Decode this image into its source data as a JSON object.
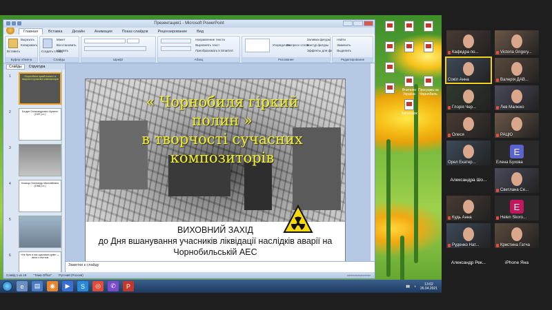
{
  "ppt": {
    "window_title": "Презентация1 - Microsoft PowerPoint",
    "tabs": [
      "Главная",
      "Вставка",
      "Дизайн",
      "Анимация",
      "Показ слайдов",
      "Рецензирование",
      "Вид"
    ],
    "ribbon_groups": [
      "Буфер обмена",
      "Слайды",
      "Шрифт",
      "Абзац",
      "Рисование",
      "Редактирование"
    ],
    "ribbon_buttons": {
      "paste": "Вставить",
      "new_slide": "Создать слайд",
      "cut": "Вырезать",
      "copy": "Копировать",
      "format": "Формат по образцу",
      "layout": "Макет",
      "reset": "Восстановить",
      "delete": "Удалить",
      "text_direction": "Направление текста",
      "align_text": "Выровнять текст",
      "smartart": "Преобразовать в SmartArt",
      "arrange": "Упорядочить",
      "quick_styles": "Экспресс-стили",
      "fill": "Заливка фигуры",
      "outline": "Контур фигуры",
      "effects": "Эффекты для фигур",
      "find": "Найти",
      "replace": "Заменить",
      "select": "Выделить"
    },
    "pane_tabs": [
      "Слайды",
      "Структура"
    ],
    "thumbnails": [
      {
        "num": "1",
        "text": "«Чорнобиля гіркий полин» в творчості сучасних композиторів"
      },
      {
        "num": "2",
        "text": "Богдан Олександрович Шумило (1957 р.н.)"
      },
      {
        "num": "3",
        "text": ""
      },
      {
        "num": "4",
        "text": "Кошиць Олександр Миколайович (1966 р.н.)"
      },
      {
        "num": "5",
        "text": ""
      },
      {
        "num": "6",
        "text": "«Не було в нас щасливих днів» — пісня з текстом"
      }
    ],
    "slide": {
      "title_lines": [
        "« Чорнобиля гіркий",
        "полин »",
        "в творчості сучасних",
        "композиторів"
      ],
      "sub_line1": "ВИХОВНИЙ ЗАХІД",
      "sub_line2": "до Дня вшанування учасників ліквідації наслідків аварії на",
      "sub_line3": "Чорнобильській АЕС"
    },
    "notes_placeholder": "Заметки к слайду",
    "status": {
      "slide": "Слайд 1 из 18",
      "theme": "\"Тема Office\"",
      "lang": "Русский (Россия)"
    }
  },
  "desktop_icons": [
    "",
    "",
    "",
    "",
    "",
    "",
    "",
    "Вчителю Україна",
    "Програма на Чорнобиль",
    "",
    "Заголовок"
  ],
  "taskbar": {
    "clock_time": "13:02",
    "clock_date": "26.04.2021"
  },
  "participants": [
    {
      "name": "Кафедра по...",
      "kind": "video",
      "mic": true
    },
    {
      "name": "Victoria Grigory...",
      "kind": "video",
      "mic": true
    },
    {
      "name": "Сокіл Анна",
      "kind": "video",
      "mic": false,
      "active": true
    },
    {
      "name": "Валерія ДАВ...",
      "kind": "video",
      "mic": true
    },
    {
      "name": "Глорія Чер...",
      "kind": "video",
      "mic": true
    },
    {
      "name": "Лев Малюко",
      "kind": "video",
      "mic": true
    },
    {
      "name": "Олеся",
      "kind": "video",
      "mic": true
    },
    {
      "name": "РАЦЮ",
      "kind": "video",
      "mic": true
    },
    {
      "name": "Орел Екатер...",
      "kind": "video",
      "mic": false
    },
    {
      "name": "Елена Бухова",
      "kind": "avatar",
      "letter": "Е",
      "color": "#5b63d0",
      "mic": false
    },
    {
      "name": "Александра Шо...",
      "kind": "text",
      "mic": false
    },
    {
      "name": "Светлана Се...",
      "kind": "video",
      "mic": true
    },
    {
      "name": "Кудь Анна",
      "kind": "video",
      "mic": true
    },
    {
      "name": "Helen Skoro...",
      "kind": "avatar",
      "letter": "E",
      "color": "#c2185b",
      "mic": true
    },
    {
      "name": "Руденко Нат...",
      "kind": "video",
      "mic": true
    },
    {
      "name": "Кристина Гатча",
      "kind": "video",
      "mic": true
    },
    {
      "name": "Александр Рек...",
      "kind": "text",
      "mic": false
    },
    {
      "name": "iPhone Яна",
      "kind": "text",
      "mic": false
    }
  ]
}
